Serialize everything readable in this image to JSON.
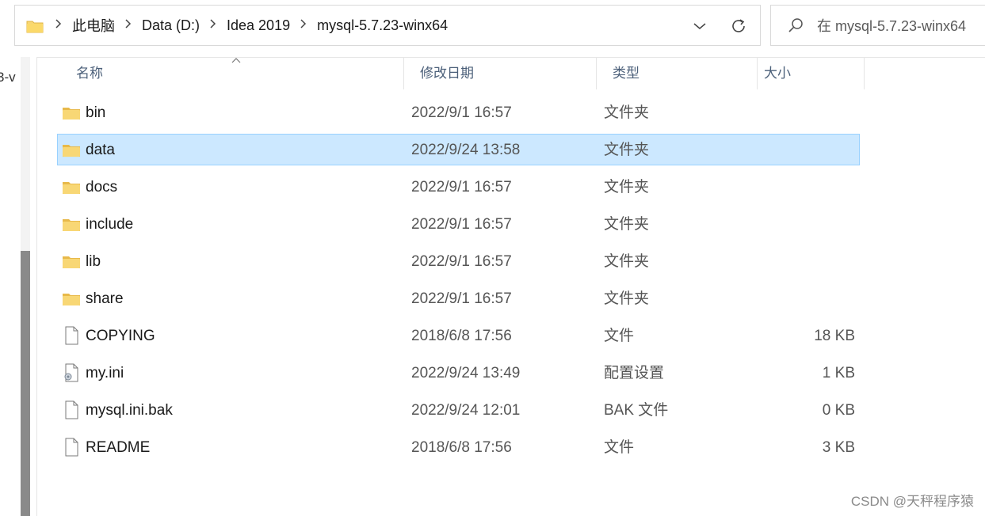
{
  "address": {
    "crumbs": [
      "此电脑",
      "Data (D:)",
      "Idea 2019",
      "mysql-5.7.23-winx64"
    ],
    "separator": ">"
  },
  "search": {
    "placeholder": "在 mysql-5.7.23-winx64"
  },
  "left_pane": {
    "partial_text": "3-v"
  },
  "columns": {
    "name": "名称",
    "date": "修改日期",
    "type": "类型",
    "size": "大小"
  },
  "files": [
    {
      "name": "bin",
      "date": "2022/9/1 16:57",
      "type": "文件夹",
      "size": "",
      "icon": "folder-icon",
      "selected": false
    },
    {
      "name": "data",
      "date": "2022/9/24 13:58",
      "type": "文件夹",
      "size": "",
      "icon": "folder-icon",
      "selected": true
    },
    {
      "name": "docs",
      "date": "2022/9/1 16:57",
      "type": "文件夹",
      "size": "",
      "icon": "folder-icon",
      "selected": false
    },
    {
      "name": "include",
      "date": "2022/9/1 16:57",
      "type": "文件夹",
      "size": "",
      "icon": "folder-icon",
      "selected": false
    },
    {
      "name": "lib",
      "date": "2022/9/1 16:57",
      "type": "文件夹",
      "size": "",
      "icon": "folder-icon",
      "selected": false
    },
    {
      "name": "share",
      "date": "2022/9/1 16:57",
      "type": "文件夹",
      "size": "",
      "icon": "folder-icon",
      "selected": false
    },
    {
      "name": "COPYING",
      "date": "2018/6/8 17:56",
      "type": "文件",
      "size": "18 KB",
      "icon": "file-icon",
      "selected": false
    },
    {
      "name": "my.ini",
      "date": "2022/9/24 13:49",
      "type": "配置设置",
      "size": "1 KB",
      "icon": "settings-file-icon",
      "selected": false
    },
    {
      "name": "mysql.ini.bak",
      "date": "2022/9/24 12:01",
      "type": "BAK 文件",
      "size": "0 KB",
      "icon": "file-icon",
      "selected": false
    },
    {
      "name": "README",
      "date": "2018/6/8 17:56",
      "type": "文件",
      "size": "3 KB",
      "icon": "file-icon",
      "selected": false
    }
  ],
  "watermark": "CSDN @天秤程序猿",
  "colors": {
    "selection_bg": "#cce8ff",
    "selection_border": "#99d1ff",
    "folder_yellow": "#f8d775",
    "header_text": "#4c607a"
  }
}
